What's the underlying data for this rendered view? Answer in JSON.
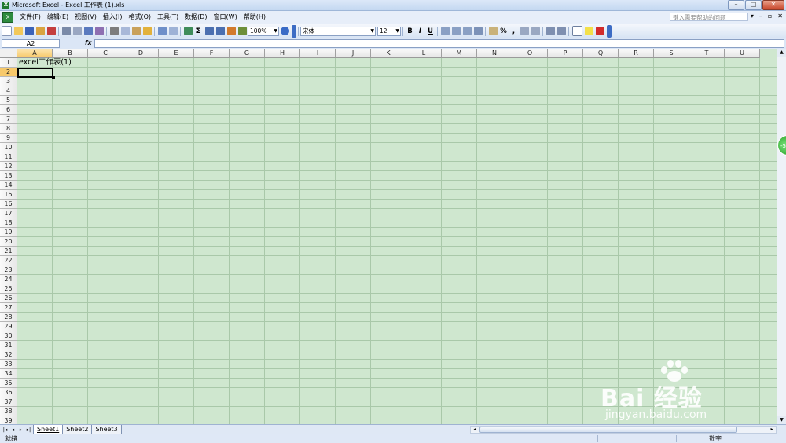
{
  "window": {
    "title": "Microsoft Excel - Excel 工作表 (1).xls",
    "controls": [
      "–",
      "□",
      "✕"
    ]
  },
  "menubar": {
    "items": [
      "文件(F)",
      "编辑(E)",
      "视图(V)",
      "插入(I)",
      "格式(O)",
      "工具(T)",
      "数据(D)",
      "窗口(W)",
      "帮助(H)"
    ],
    "help_placeholder": "键入需要帮助的问题",
    "right_controls": [
      "▾",
      "–",
      "▫",
      "✕"
    ]
  },
  "toolbar": {
    "zoom": "100%",
    "font": "宋体",
    "font_size": "12",
    "bold": "B",
    "italic": "I",
    "underline": "U",
    "sum": "Σ",
    "percent": "%",
    "comma": ",",
    "icons": [
      "new-icon",
      "open-icon",
      "save-icon",
      "permission-icon",
      "email-icon",
      "print-icon",
      "print-preview-icon",
      "spelling-icon",
      "research-icon",
      "cut-icon",
      "copy-icon",
      "paste-icon",
      "format-painter-icon",
      "undo-icon",
      "redo-icon",
      "hyperlink-icon",
      "sort-ascending-icon",
      "sort-descending-icon",
      "chart-wizard-icon",
      "drawing-icon"
    ]
  },
  "formula_bar": {
    "name_box": "A2",
    "fx": "fx",
    "formula": ""
  },
  "sheet": {
    "columns": [
      "A",
      "B",
      "C",
      "D",
      "E",
      "F",
      "G",
      "H",
      "I",
      "J",
      "K",
      "L",
      "M",
      "N",
      "O",
      "P",
      "Q",
      "R",
      "S",
      "T",
      "U"
    ],
    "rows": [
      "1",
      "2",
      "3",
      "4",
      "5",
      "6",
      "7",
      "8",
      "9",
      "10",
      "11",
      "12",
      "13",
      "14",
      "15",
      "16",
      "17",
      "18",
      "19",
      "20",
      "21",
      "22",
      "23",
      "24",
      "25",
      "26",
      "27",
      "28",
      "29",
      "30",
      "31",
      "32",
      "33",
      "34",
      "35",
      "36",
      "37",
      "38",
      "39"
    ],
    "active_cell": "A2",
    "cells": {
      "A1": "excel工作表(1)"
    },
    "background_color": "#cfe7cf",
    "header_highlight": "#f7c96b"
  },
  "tabs": {
    "nav": [
      "|◂",
      "◂",
      "▸",
      "▸|"
    ],
    "sheets": [
      "Sheet1",
      "Sheet2",
      "Sheet3"
    ],
    "active": "Sheet1"
  },
  "status": {
    "left": "就绪",
    "mode": "数字"
  },
  "watermark": {
    "main": "Bai 经验",
    "sub": "jingyan.baidu.com"
  },
  "side_badge": "-5"
}
